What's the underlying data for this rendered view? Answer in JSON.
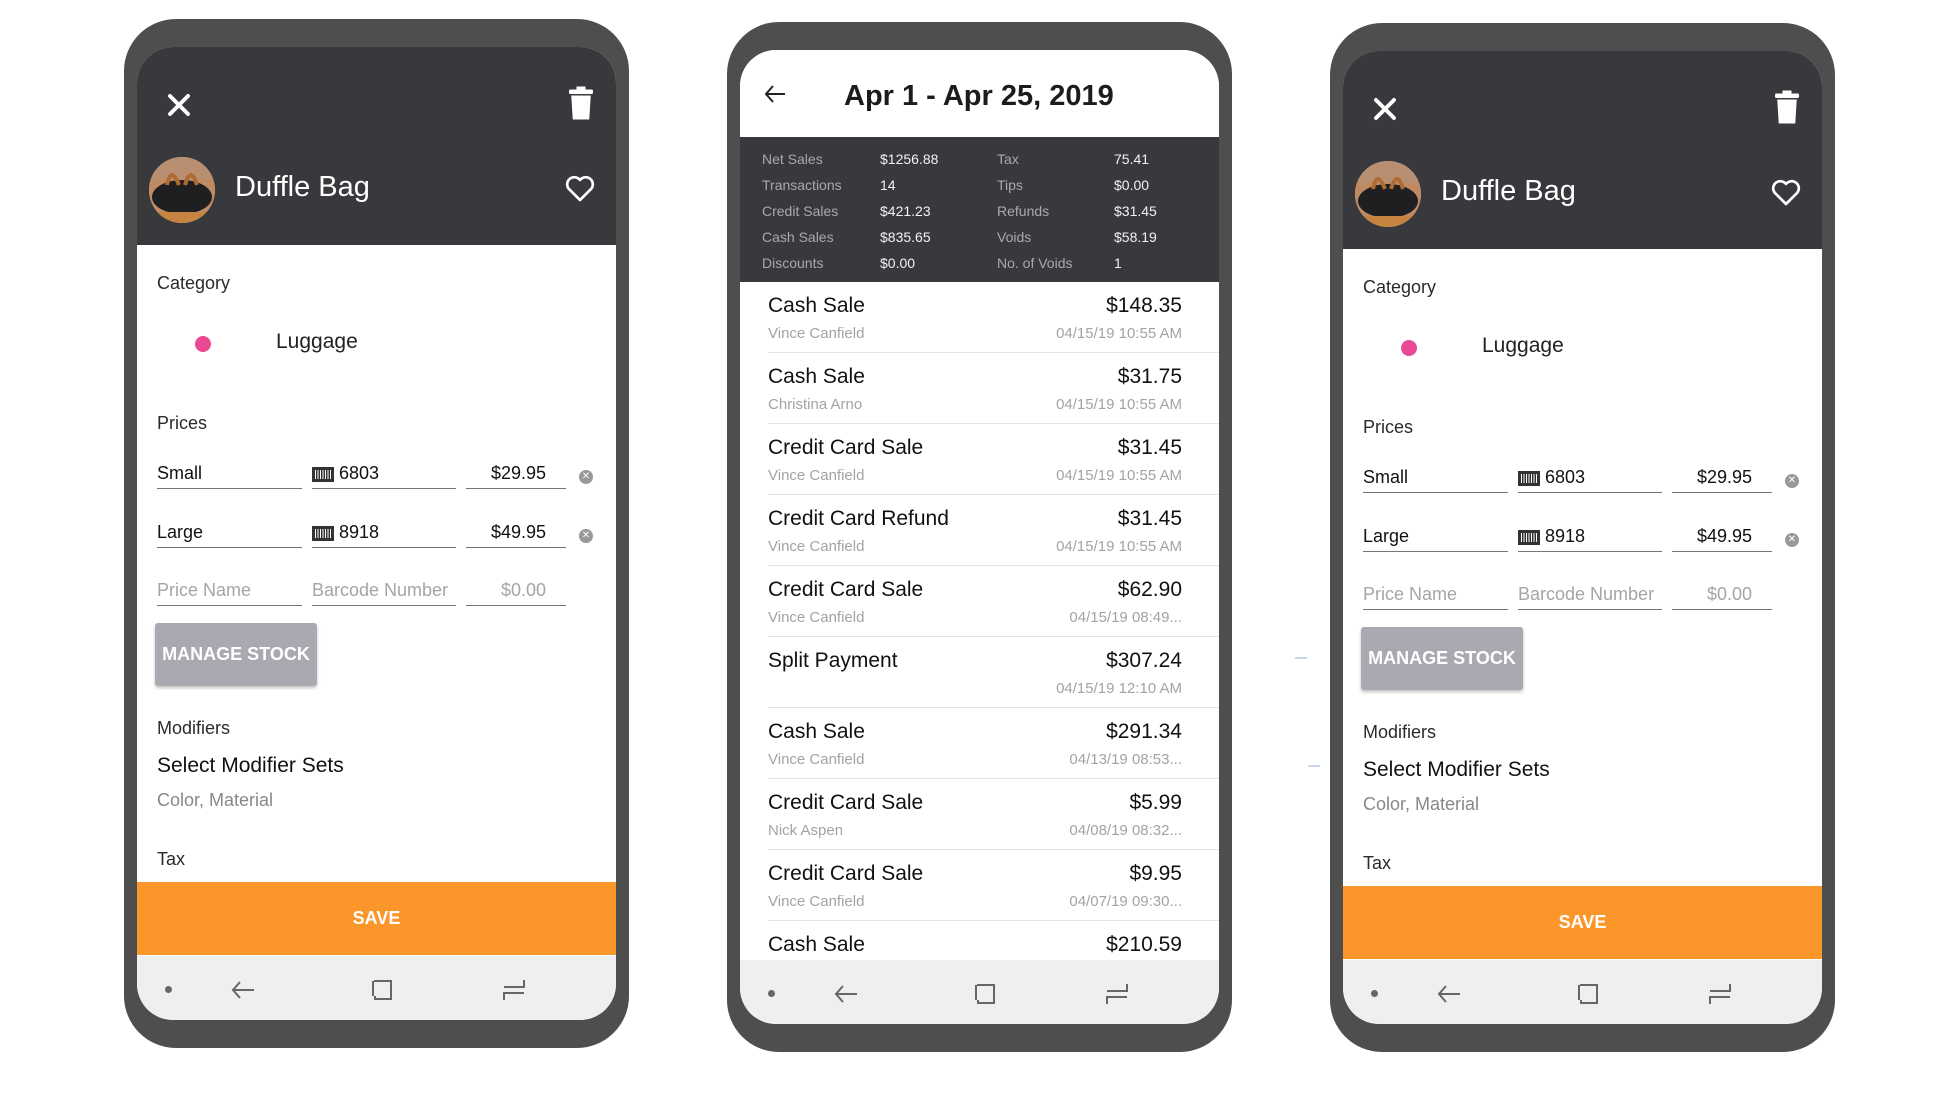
{
  "item_editor": {
    "title": "Duffle Bag",
    "icons": {
      "close": "close-icon",
      "delete": "trash-icon",
      "favorite": "heart-outline-icon"
    },
    "category": {
      "label": "Category",
      "value": "Luggage",
      "color": "#ea4a94"
    },
    "prices": {
      "label": "Prices",
      "rows": [
        {
          "name": "Small",
          "barcode": "6803",
          "price": "$29.95"
        },
        {
          "name": "Large",
          "barcode": "8918",
          "price": "$49.95"
        }
      ],
      "new_row": {
        "name_placeholder": "Price Name",
        "barcode_placeholder": "Barcode Number",
        "price_placeholder": "$0.00"
      }
    },
    "manage_stock_label": "MANAGE STOCK",
    "modifiers": {
      "label": "Modifiers",
      "select_label": "Select Modifier Sets",
      "selected": "Color, Material"
    },
    "tax_label": "Tax",
    "save_label": "SAVE",
    "save_color": "#fb962a"
  },
  "report": {
    "title": "Apr 1 - Apr 25, 2019",
    "summary": [
      {
        "label": "Net Sales",
        "value": "$1256.88",
        "label2": "Tax",
        "value2": "75.41"
      },
      {
        "label": "Transactions",
        "value": "14",
        "label2": "Tips",
        "value2": "$0.00"
      },
      {
        "label": "Credit Sales",
        "value": "$421.23",
        "label2": "Refunds",
        "value2": "$31.45"
      },
      {
        "label": "Cash Sales",
        "value": "$835.65",
        "label2": "Voids",
        "value2": "$58.19"
      },
      {
        "label": "Discounts",
        "value": "$0.00",
        "label2": "No. of Voids",
        "value2": "1"
      }
    ],
    "transactions": [
      {
        "type": "Cash Sale",
        "amount": "$148.35",
        "customer": "Vince Canfield",
        "time": "04/15/19 10:55 AM"
      },
      {
        "type": "Cash Sale",
        "amount": "$31.75",
        "customer": "Christina Arno",
        "time": "04/15/19 10:55 AM"
      },
      {
        "type": "Credit Card Sale",
        "amount": "$31.45",
        "customer": "Vince Canfield",
        "time": "04/15/19 10:55 AM"
      },
      {
        "type": "Credit Card Refund",
        "amount": "$31.45",
        "customer": "Vince Canfield",
        "time": "04/15/19 10:55 AM"
      },
      {
        "type": "Credit Card Sale",
        "amount": "$62.90",
        "customer": "Vince Canfield",
        "time": "04/15/19 08:49..."
      },
      {
        "type": "Split Payment",
        "amount": "$307.24",
        "customer": "",
        "time": "04/15/19 12:10 AM"
      },
      {
        "type": "Cash Sale",
        "amount": "$291.34",
        "customer": "Vince Canfield",
        "time": "04/13/19 08:53..."
      },
      {
        "type": "Credit Card Sale",
        "amount": "$5.99",
        "customer": "Nick Aspen",
        "time": "04/08/19 08:32..."
      },
      {
        "type": "Credit Card Sale",
        "amount": "$9.95",
        "customer": "Vince Canfield",
        "time": "04/07/19 09:30..."
      },
      {
        "type": "Cash Sale",
        "amount": "$210.59",
        "customer": "",
        "time": ""
      }
    ]
  },
  "navbar": {
    "icons": [
      "nav-dot-icon",
      "back-icon",
      "home-icon",
      "recents-icon"
    ]
  }
}
